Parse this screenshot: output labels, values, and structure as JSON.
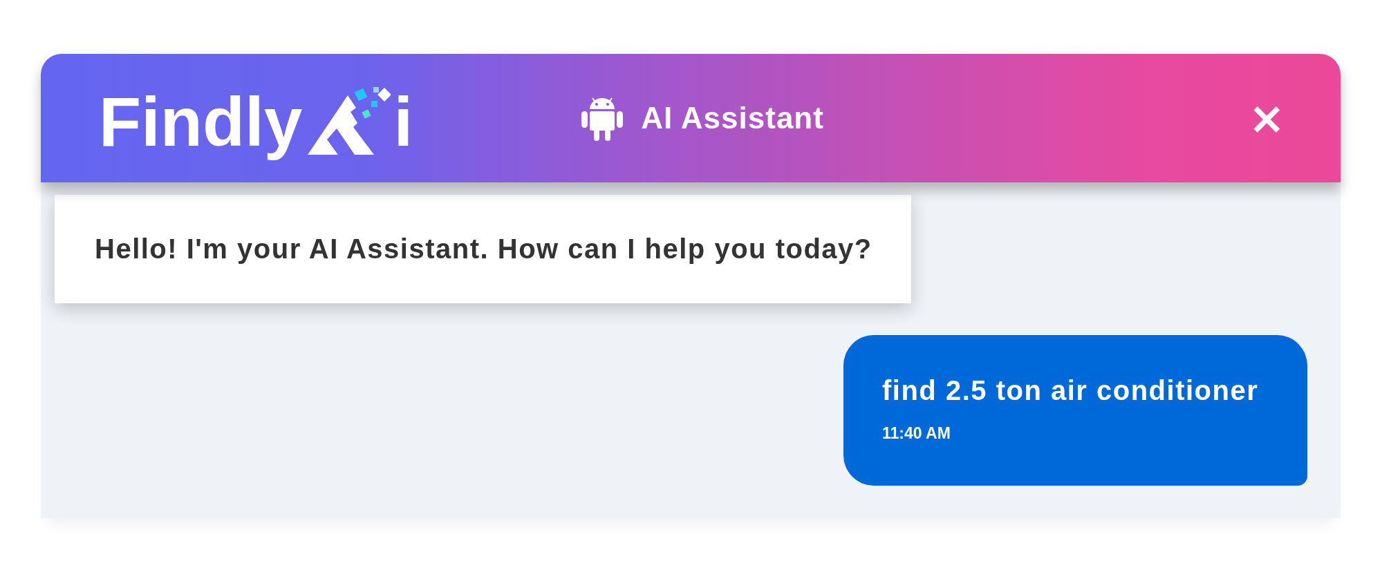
{
  "header": {
    "logo": {
      "text": "Findly",
      "suffix": "i"
    },
    "title": "AI Assistant",
    "close": "×"
  },
  "messages": [
    {
      "kind": "bot",
      "text": "Hello! I'm your AI Assistant. How can I help you today?"
    },
    {
      "kind": "user",
      "text": "find 2.5 ton air conditioner",
      "time": "11:40 AM"
    }
  ]
}
